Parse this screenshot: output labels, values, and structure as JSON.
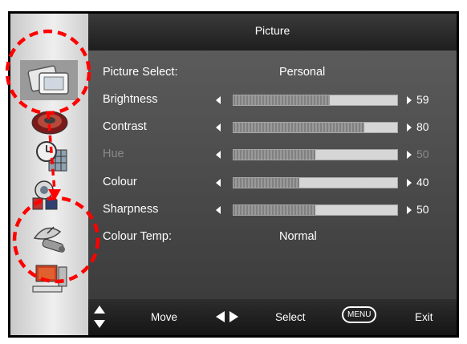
{
  "menu": {
    "title": "Picture",
    "rows": [
      {
        "label": "Picture Select:",
        "value": "Personal"
      },
      {
        "label": "Brightness",
        "level": 59,
        "display": "59"
      },
      {
        "label": "Contrast",
        "level": 80,
        "display": "80"
      },
      {
        "label": "Hue",
        "level": 50,
        "display": "50",
        "disabled": true
      },
      {
        "label": "Colour",
        "level": 40,
        "display": "40"
      },
      {
        "label": "Sharpness",
        "level": 50,
        "display": "50"
      },
      {
        "label": "Colour Temp:",
        "value": "Normal"
      }
    ]
  },
  "sidebar": {
    "icons": [
      "picture-icon",
      "sound-icon",
      "clock-icon",
      "lock-icon",
      "satellite-dish-icon",
      "computer-icon"
    ],
    "active_index": 0
  },
  "footer": {
    "move_label": "Move",
    "select_label": "Select",
    "menu_key_label": "MENU",
    "exit_label": "Exit"
  },
  "annotation": {
    "color": "#ff0000"
  }
}
